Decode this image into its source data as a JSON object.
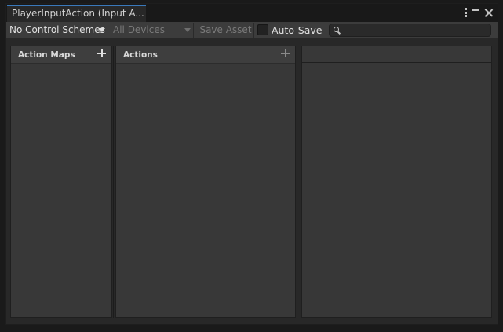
{
  "tab": {
    "title": "PlayerInputAction (Input A..."
  },
  "window_controls": {
    "menu_icon": "kebab-menu-icon",
    "maximize_icon": "maximize-icon",
    "close_icon": "close-icon"
  },
  "toolbar": {
    "control_scheme": "No Control Schemes",
    "devices": "All Devices",
    "save_asset": "Save Asset",
    "auto_save_label": "Auto-Save",
    "auto_save_checked": false,
    "search_value": "",
    "search_placeholder": ""
  },
  "panes": {
    "action_maps": {
      "title": "Action Maps"
    },
    "actions": {
      "title": "Actions"
    },
    "properties": {
      "title": ""
    }
  },
  "colors": {
    "accent": "#3a79bb",
    "background": "#282828",
    "pane": "#383838"
  }
}
